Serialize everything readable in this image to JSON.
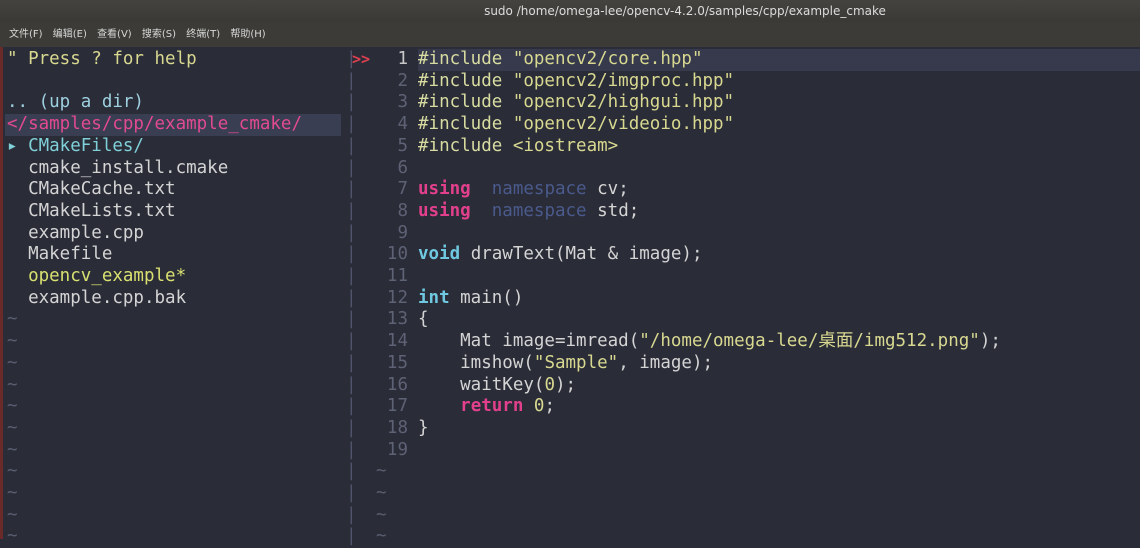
{
  "window": {
    "title": "sudo  /home/omega-lee/opencv-4.2.0/samples/cpp/example_cmake"
  },
  "menu": [
    "文件(F)",
    "编辑(E)",
    "查看(V)",
    "搜索(S)",
    "终端(T)",
    "帮助(H)"
  ],
  "tree": {
    "help": "\" Press ? for help",
    "up_dir": ".. (up a dir)",
    "current_dir": "</samples/cpp/example_cmake/",
    "files": [
      {
        "name": "▸ CMakeFiles/",
        "type": "dir"
      },
      {
        "name": "  cmake_install.cmake",
        "type": "file"
      },
      {
        "name": "  CMakeCache.txt",
        "type": "file"
      },
      {
        "name": "  CMakeLists.txt",
        "type": "file"
      },
      {
        "name": "  example.cpp",
        "type": "file"
      },
      {
        "name": "  Makefile",
        "type": "file"
      },
      {
        "name": "  opencv_example*",
        "type": "exec"
      },
      {
        "name": "  example.cpp.bak",
        "type": "file"
      }
    ]
  },
  "editor": {
    "sign": ">>",
    "lines": [
      [
        [
          "pp",
          "#include "
        ],
        [
          "str",
          "\"opencv2/core.hpp\""
        ]
      ],
      [
        [
          "pp",
          "#include "
        ],
        [
          "str",
          "\"opencv2/imgproc.hpp\""
        ]
      ],
      [
        [
          "pp",
          "#include "
        ],
        [
          "str",
          "\"opencv2/highgui.hpp\""
        ]
      ],
      [
        [
          "pp",
          "#include "
        ],
        [
          "str",
          "\"opencv2/videoio.hpp\""
        ]
      ],
      [
        [
          "pp",
          "#include "
        ],
        [
          "str",
          "<iostream>"
        ]
      ],
      [],
      [
        [
          "kw",
          "using"
        ],
        [
          "",
          "  "
        ],
        [
          "ns",
          "namespace"
        ],
        [
          "",
          " cv;"
        ]
      ],
      [
        [
          "kw",
          "using"
        ],
        [
          "",
          "  "
        ],
        [
          "ns",
          "namespace"
        ],
        [
          "",
          " std;"
        ]
      ],
      [],
      [
        [
          "ty",
          "void"
        ],
        [
          "",
          " drawText(Mat & image);"
        ]
      ],
      [],
      [
        [
          "ty",
          "int"
        ],
        [
          "",
          " main()"
        ]
      ],
      [
        [
          "",
          "{"
        ]
      ],
      [
        [
          "",
          "    Mat image=imread("
        ],
        [
          "str",
          "\"/home/omega-lee/桌面/img512.png\""
        ],
        [
          "",
          ");"
        ]
      ],
      [
        [
          "",
          "    imshow("
        ],
        [
          "str",
          "\"Sample\""
        ],
        [
          "",
          ", image);"
        ]
      ],
      [
        [
          "",
          "    waitKey("
        ],
        [
          "nm",
          "0"
        ],
        [
          "",
          ");"
        ]
      ],
      [
        [
          "",
          "    "
        ],
        [
          "kw",
          "return"
        ],
        [
          "",
          " "
        ],
        [
          "nm",
          "0"
        ],
        [
          "",
          ";"
        ]
      ],
      [
        [
          "",
          "}"
        ]
      ],
      []
    ],
    "tilde": "~"
  }
}
